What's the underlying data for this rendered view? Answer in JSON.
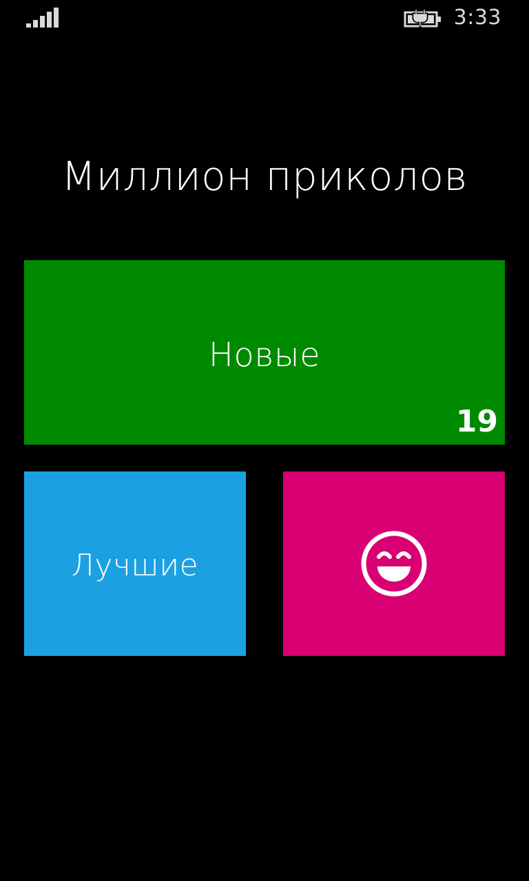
{
  "status_bar": {
    "time": "3:33",
    "signal_icon": "signal-strength-icon",
    "battery_icon": "battery-charging-icon"
  },
  "app": {
    "title": "Миллион приколов"
  },
  "tiles": {
    "new": {
      "label": "Новые",
      "count": "19",
      "color": "#008a00"
    },
    "best": {
      "label": "Лучшие",
      "color": "#1ba1e2"
    },
    "random": {
      "icon": "laughing-smiley-icon",
      "color": "#d80073"
    }
  }
}
